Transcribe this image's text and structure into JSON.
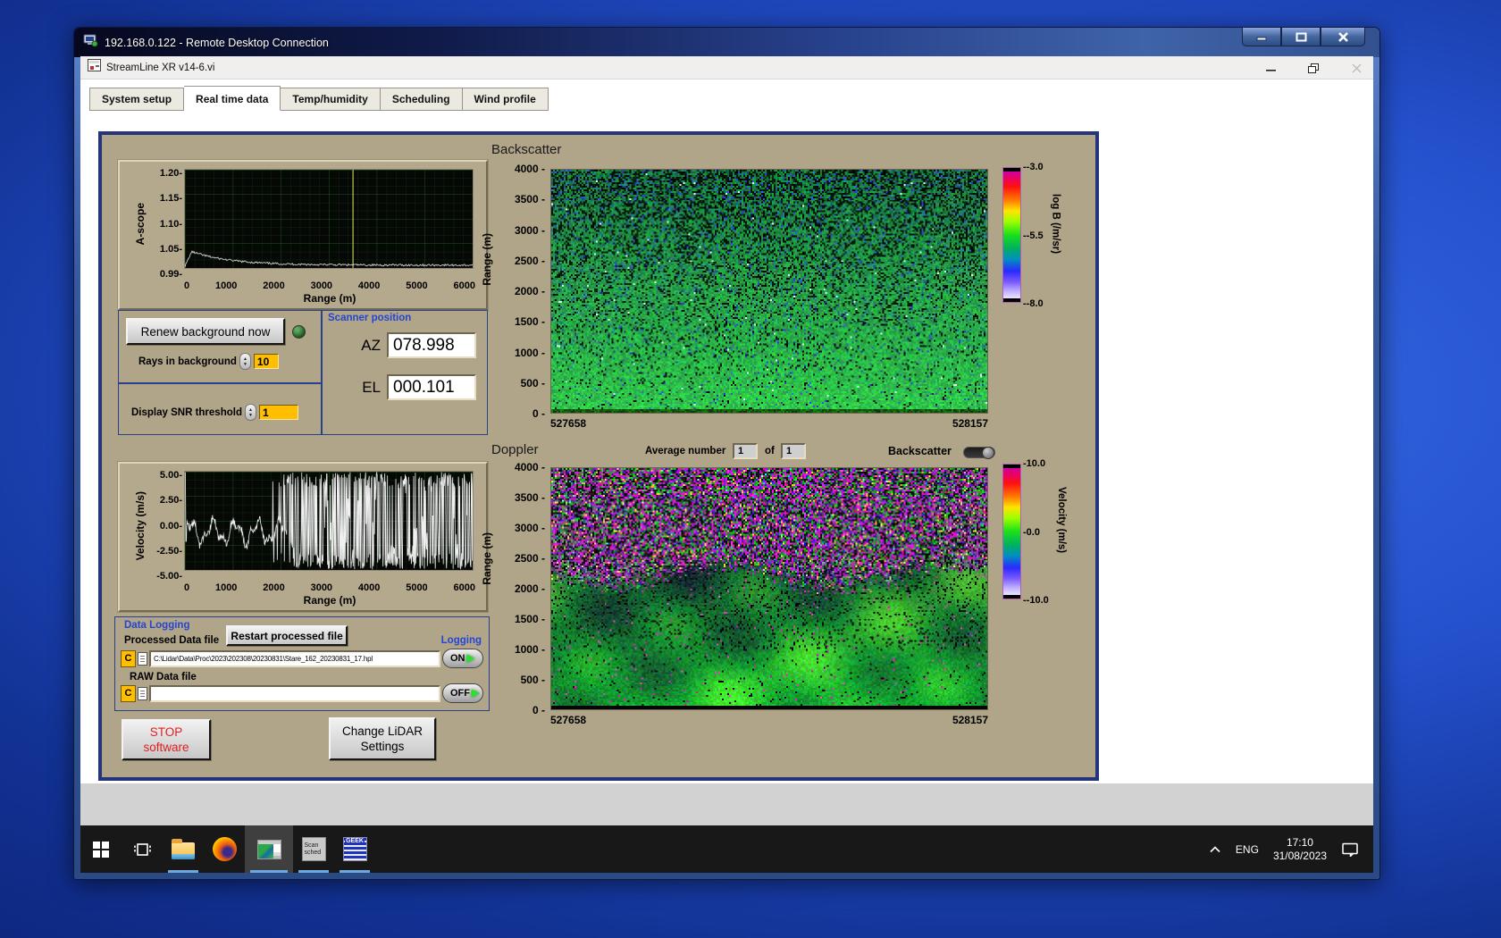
{
  "rdp": {
    "title": "192.168.0.122 - Remote Desktop Connection"
  },
  "app": {
    "title": "StreamLine XR v14-6.vi",
    "tabs": [
      "System setup",
      "Real time data",
      "Temp/humidity",
      "Scheduling",
      "Wind profile"
    ],
    "selected_tab": "Real time data"
  },
  "ascope_plot": {
    "ylabel": "A-scope",
    "xlabel": "Range (m)",
    "yticks": [
      "1.20",
      "1.15",
      "1.10",
      "1.05",
      "0.99"
    ],
    "xticks": [
      "0",
      "1000",
      "2000",
      "3000",
      "4000",
      "5000",
      "6000"
    ],
    "ymin": 0.99,
    "ymax": 1.2,
    "xmin": 0,
    "xmax": 6000,
    "cursor_x": 3500
  },
  "background_controls": {
    "renew_button": "Renew background now",
    "rays_label": "Rays in background",
    "rays_value": "10",
    "snr_label": "Display SNR threshold",
    "snr_value": "1"
  },
  "scanner": {
    "title": "Scanner position",
    "az_label": "AZ",
    "az_value": "078.998",
    "el_label": "EL",
    "el_value": "000.101"
  },
  "velocity_plot": {
    "ylabel": "Velocity (m/s)",
    "xlabel": "Range (m)",
    "yticks": [
      "5.00",
      "2.50",
      "0.00",
      "-2.50",
      "-5.00"
    ],
    "xticks": [
      "0",
      "1000",
      "2000",
      "3000",
      "4000",
      "5000",
      "6000"
    ],
    "ymin": -5,
    "ymax": 5,
    "xmin": 0,
    "xmax": 6000
  },
  "backscatter_plot": {
    "title": "Backscatter",
    "ylabel": "Range (m)",
    "yticks": [
      "4000",
      "3500",
      "3000",
      "2500",
      "2000",
      "1500",
      "1000",
      "500",
      "0"
    ],
    "xtick_left": "527658",
    "xtick_right": "528157",
    "colorbar": {
      "ticks": [
        "-3.0",
        "-5.5",
        "-8.0"
      ],
      "label": "log B (/m/sr)"
    }
  },
  "doppler_plot": {
    "title": "Doppler",
    "average_label": "Average number",
    "average_value": "1",
    "of_label": "of",
    "average_total": "1",
    "toggle_label": "Backscatter",
    "ylabel": "Range (m)",
    "yticks": [
      "4000",
      "3500",
      "3000",
      "2500",
      "2000",
      "1500",
      "1000",
      "500",
      "0"
    ],
    "xtick_left": "527658",
    "xtick_right": "528157",
    "colorbar": {
      "ticks": [
        "10.0",
        "0.0",
        "-10.0"
      ],
      "label": "Velocity (m/s)"
    }
  },
  "logging": {
    "title": "Data Logging",
    "processed_label": "Processed Data file",
    "restart_button": "Restart processed file",
    "logging_label": "Logging",
    "processed_drive": "C",
    "processed_path": "C:\\Lidar\\Data\\Proc\\2023\\202308\\20230831\\Stare_162_20230831_17.hpl",
    "processed_state": "ON",
    "raw_label": "RAW Data file",
    "raw_drive": "C",
    "raw_path": "",
    "raw_state": "OFF"
  },
  "actions": {
    "stop_line1": "STOP",
    "stop_line2": "software",
    "change_line1": "Change LiDAR",
    "change_line2": "Settings"
  },
  "taskbar": {
    "language": "ENG",
    "time": "17:10",
    "date": "31/08/2023",
    "scan_sched_line1": "Scan",
    "scan_sched_line2": "sched",
    "geek_label": "GEEK"
  },
  "colors": {
    "blue_label": "#2446d2",
    "panel_tan": "#b0a489",
    "orange_field": "#ffbe00",
    "taskbar_underline": "#6fa8dc"
  }
}
